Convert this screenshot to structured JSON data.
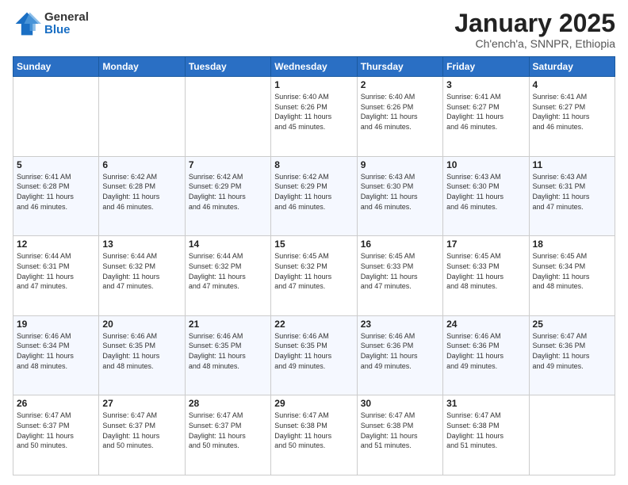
{
  "logo": {
    "general": "General",
    "blue": "Blue"
  },
  "title": "January 2025",
  "subtitle": "Ch'ench'a, SNNPR, Ethiopia",
  "days_header": [
    "Sunday",
    "Monday",
    "Tuesday",
    "Wednesday",
    "Thursday",
    "Friday",
    "Saturday"
  ],
  "weeks": [
    [
      {
        "day": "",
        "info": ""
      },
      {
        "day": "",
        "info": ""
      },
      {
        "day": "",
        "info": ""
      },
      {
        "day": "1",
        "info": "Sunrise: 6:40 AM\nSunset: 6:26 PM\nDaylight: 11 hours\nand 45 minutes."
      },
      {
        "day": "2",
        "info": "Sunrise: 6:40 AM\nSunset: 6:26 PM\nDaylight: 11 hours\nand 46 minutes."
      },
      {
        "day": "3",
        "info": "Sunrise: 6:41 AM\nSunset: 6:27 PM\nDaylight: 11 hours\nand 46 minutes."
      },
      {
        "day": "4",
        "info": "Sunrise: 6:41 AM\nSunset: 6:27 PM\nDaylight: 11 hours\nand 46 minutes."
      }
    ],
    [
      {
        "day": "5",
        "info": "Sunrise: 6:41 AM\nSunset: 6:28 PM\nDaylight: 11 hours\nand 46 minutes."
      },
      {
        "day": "6",
        "info": "Sunrise: 6:42 AM\nSunset: 6:28 PM\nDaylight: 11 hours\nand 46 minutes."
      },
      {
        "day": "7",
        "info": "Sunrise: 6:42 AM\nSunset: 6:29 PM\nDaylight: 11 hours\nand 46 minutes."
      },
      {
        "day": "8",
        "info": "Sunrise: 6:42 AM\nSunset: 6:29 PM\nDaylight: 11 hours\nand 46 minutes."
      },
      {
        "day": "9",
        "info": "Sunrise: 6:43 AM\nSunset: 6:30 PM\nDaylight: 11 hours\nand 46 minutes."
      },
      {
        "day": "10",
        "info": "Sunrise: 6:43 AM\nSunset: 6:30 PM\nDaylight: 11 hours\nand 46 minutes."
      },
      {
        "day": "11",
        "info": "Sunrise: 6:43 AM\nSunset: 6:31 PM\nDaylight: 11 hours\nand 47 minutes."
      }
    ],
    [
      {
        "day": "12",
        "info": "Sunrise: 6:44 AM\nSunset: 6:31 PM\nDaylight: 11 hours\nand 47 minutes."
      },
      {
        "day": "13",
        "info": "Sunrise: 6:44 AM\nSunset: 6:32 PM\nDaylight: 11 hours\nand 47 minutes."
      },
      {
        "day": "14",
        "info": "Sunrise: 6:44 AM\nSunset: 6:32 PM\nDaylight: 11 hours\nand 47 minutes."
      },
      {
        "day": "15",
        "info": "Sunrise: 6:45 AM\nSunset: 6:32 PM\nDaylight: 11 hours\nand 47 minutes."
      },
      {
        "day": "16",
        "info": "Sunrise: 6:45 AM\nSunset: 6:33 PM\nDaylight: 11 hours\nand 47 minutes."
      },
      {
        "day": "17",
        "info": "Sunrise: 6:45 AM\nSunset: 6:33 PM\nDaylight: 11 hours\nand 48 minutes."
      },
      {
        "day": "18",
        "info": "Sunrise: 6:45 AM\nSunset: 6:34 PM\nDaylight: 11 hours\nand 48 minutes."
      }
    ],
    [
      {
        "day": "19",
        "info": "Sunrise: 6:46 AM\nSunset: 6:34 PM\nDaylight: 11 hours\nand 48 minutes."
      },
      {
        "day": "20",
        "info": "Sunrise: 6:46 AM\nSunset: 6:35 PM\nDaylight: 11 hours\nand 48 minutes."
      },
      {
        "day": "21",
        "info": "Sunrise: 6:46 AM\nSunset: 6:35 PM\nDaylight: 11 hours\nand 48 minutes."
      },
      {
        "day": "22",
        "info": "Sunrise: 6:46 AM\nSunset: 6:35 PM\nDaylight: 11 hours\nand 49 minutes."
      },
      {
        "day": "23",
        "info": "Sunrise: 6:46 AM\nSunset: 6:36 PM\nDaylight: 11 hours\nand 49 minutes."
      },
      {
        "day": "24",
        "info": "Sunrise: 6:46 AM\nSunset: 6:36 PM\nDaylight: 11 hours\nand 49 minutes."
      },
      {
        "day": "25",
        "info": "Sunrise: 6:47 AM\nSunset: 6:36 PM\nDaylight: 11 hours\nand 49 minutes."
      }
    ],
    [
      {
        "day": "26",
        "info": "Sunrise: 6:47 AM\nSunset: 6:37 PM\nDaylight: 11 hours\nand 50 minutes."
      },
      {
        "day": "27",
        "info": "Sunrise: 6:47 AM\nSunset: 6:37 PM\nDaylight: 11 hours\nand 50 minutes."
      },
      {
        "day": "28",
        "info": "Sunrise: 6:47 AM\nSunset: 6:37 PM\nDaylight: 11 hours\nand 50 minutes."
      },
      {
        "day": "29",
        "info": "Sunrise: 6:47 AM\nSunset: 6:38 PM\nDaylight: 11 hours\nand 50 minutes."
      },
      {
        "day": "30",
        "info": "Sunrise: 6:47 AM\nSunset: 6:38 PM\nDaylight: 11 hours\nand 51 minutes."
      },
      {
        "day": "31",
        "info": "Sunrise: 6:47 AM\nSunset: 6:38 PM\nDaylight: 11 hours\nand 51 minutes."
      },
      {
        "day": "",
        "info": ""
      }
    ]
  ]
}
